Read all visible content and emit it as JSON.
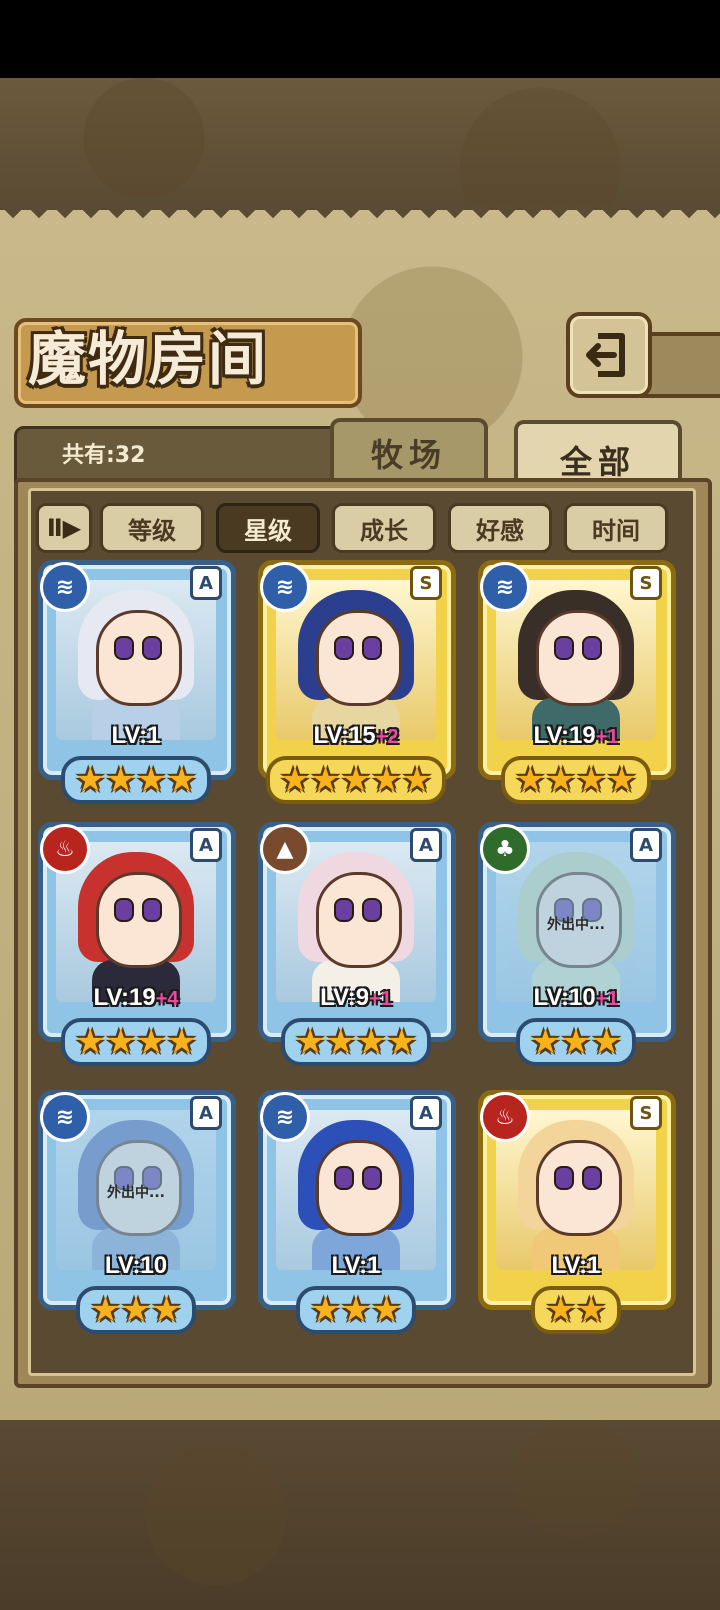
{
  "header": {
    "title": "魔物房间",
    "back_icon": "back-arrow-icon",
    "total_label": "共有:32"
  },
  "tabs": [
    {
      "label": "牧场",
      "active": false
    },
    {
      "label": "全部",
      "active": true
    }
  ],
  "sort": {
    "toggle_label": "Ⅱ▶",
    "buttons": [
      {
        "label": "等级",
        "active": false
      },
      {
        "label": "星级",
        "active": true
      },
      {
        "label": "成长",
        "active": false
      },
      {
        "label": "好感",
        "active": false
      },
      {
        "label": "时间",
        "active": false
      }
    ]
  },
  "cards": [
    {
      "element": "water",
      "rank": "A",
      "level": "LV:1",
      "bonus": "",
      "stars": 4,
      "away": ""
    },
    {
      "element": "water",
      "rank": "S",
      "level": "LV:15",
      "bonus": "+2",
      "stars": 5,
      "away": ""
    },
    {
      "element": "water",
      "rank": "S",
      "level": "LV:19",
      "bonus": "+1",
      "stars": 4,
      "away": ""
    },
    {
      "element": "fire",
      "rank": "A",
      "level": "LV:19",
      "bonus": "+4",
      "stars": 4,
      "away": ""
    },
    {
      "element": "earth",
      "rank": "A",
      "level": "LV:9",
      "bonus": "+1",
      "stars": 4,
      "away": ""
    },
    {
      "element": "wood",
      "rank": "A",
      "level": "LV:10",
      "bonus": "+1",
      "stars": 3,
      "away": "外出中..."
    },
    {
      "element": "water",
      "rank": "A",
      "level": "LV:10",
      "bonus": "",
      "stars": 3,
      "away": "外出中..."
    },
    {
      "element": "water",
      "rank": "A",
      "level": "LV:1",
      "bonus": "",
      "stars": 3,
      "away": ""
    },
    {
      "element": "fire",
      "rank": "S",
      "level": "LV:1",
      "bonus": "",
      "stars": 2,
      "away": ""
    }
  ]
}
